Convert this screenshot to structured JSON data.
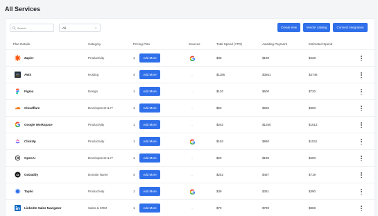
{
  "page": {
    "title": "All Services"
  },
  "toolbar": {
    "search_placeholder": "Search",
    "filter_value": "All",
    "create_new_label": "Create new",
    "vendor_catalog_label": "Vendor catalog",
    "connect_integration_label": "Connect integration"
  },
  "table": {
    "columns": [
      "Plan Details",
      "Category",
      "Pricing Plan",
      "Sources",
      "Total Spend (YTD)",
      "Awaiting Payment",
      "Estimated Spend"
    ],
    "add_more_label": "Add More",
    "rows": [
      {
        "name": "Zapier",
        "logo": "zapier-logo",
        "category": "Productivity",
        "plans": "1",
        "source": "google-icon",
        "ytd": "$38",
        "awaiting": "$190",
        "estimated": "$228"
      },
      {
        "name": "AWS",
        "logo": "aws-logo",
        "category": "Hosting",
        "plans": "4",
        "source": "-",
        "ytd": "$1185",
        "awaiting": "$3561",
        "estimated": "$4746"
      },
      {
        "name": "Figma",
        "logo": "figma-logo",
        "category": "Design",
        "plans": "1",
        "source": "-",
        "ytd": "$120",
        "awaiting": "$600",
        "estimated": "$720"
      },
      {
        "name": "Cloudflare",
        "logo": "cloudflare-logo",
        "category": "Development & IT",
        "plans": "1",
        "source": "-",
        "ytd": "$50",
        "awaiting": "$250",
        "estimated": "$300"
      },
      {
        "name": "Google Workspace",
        "logo": "google-logo",
        "category": "Productivity",
        "plans": "1",
        "source": "-",
        "ytd": "$253",
        "awaiting": "$1260",
        "estimated": "$1513"
      },
      {
        "name": "ClickUp",
        "logo": "clickup-logo",
        "category": "Productivity",
        "plans": "1",
        "source": "google-icon",
        "ytd": "$192",
        "awaiting": "$960",
        "estimated": "$1152"
      },
      {
        "name": "OpenAI",
        "logo": "openai-logo",
        "category": "Development & IT",
        "plans": "1",
        "source": "-",
        "ytd": "$20",
        "awaiting": "$180",
        "estimated": "$200"
      },
      {
        "name": "GoDaddy",
        "logo": "godaddy-logo",
        "category": "Domain Name",
        "plans": "4",
        "source": "-",
        "ytd": "$252",
        "awaiting": "$467",
        "estimated": "$719"
      },
      {
        "name": "Taplio",
        "logo": "taplio-logo",
        "category": "Productivity",
        "plans": "1",
        "source": "google-icon",
        "ytd": "$39",
        "awaiting": "$351",
        "estimated": "$390"
      },
      {
        "name": "LinkedIn Sales Navigator",
        "logo": "linkedin-logo",
        "category": "Sales & CRM",
        "plans": "1",
        "source": "-",
        "ytd": "$79",
        "awaiting": "$790",
        "estimated": "$869"
      }
    ]
  },
  "colors": {
    "accent": "#2f6fea",
    "background": "#f4f5f7"
  }
}
